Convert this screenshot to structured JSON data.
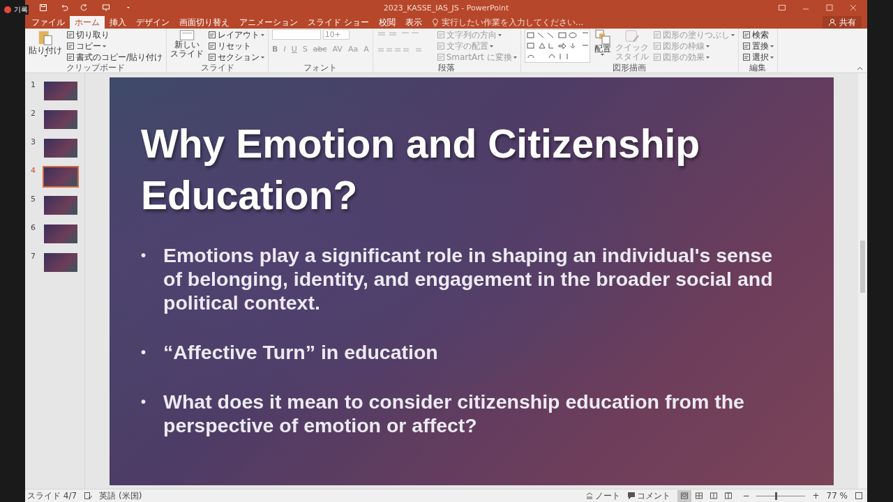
{
  "recording": {
    "label": "기록"
  },
  "window": {
    "title": "2023_KASSE_IAS_JS - PowerPoint"
  },
  "tabs": [
    {
      "label": "ファイル",
      "selected": false
    },
    {
      "label": "ホーム",
      "selected": true
    },
    {
      "label": "挿入",
      "selected": false
    },
    {
      "label": "デザイン",
      "selected": false
    },
    {
      "label": "画面切り替え",
      "selected": false
    },
    {
      "label": "アニメーション",
      "selected": false
    },
    {
      "label": "スライド ショー",
      "selected": false
    },
    {
      "label": "校閲",
      "selected": false
    },
    {
      "label": "表示",
      "selected": false
    }
  ],
  "tell_me": {
    "placeholder": "実行したい作業を入力してください..."
  },
  "share": {
    "label": "共有"
  },
  "ribbon": {
    "clipboard": {
      "label": "クリップボード",
      "paste": "貼り付け",
      "items": [
        {
          "label": "切り取り",
          "dropdown": false
        },
        {
          "label": "コピー",
          "dropdown": true
        },
        {
          "label": "書式のコピー/貼り付け",
          "dropdown": false
        }
      ]
    },
    "slides": {
      "label": "スライド",
      "new_slide": [
        "新しい",
        "スライド"
      ],
      "items": [
        {
          "label": "レイアウト",
          "dropdown": true
        },
        {
          "label": "リセット",
          "dropdown": false
        },
        {
          "label": "セクション",
          "dropdown": true
        }
      ]
    },
    "font": {
      "label": "フォント",
      "disabled": true,
      "font_size": "10+",
      "buttons": [
        "B",
        "I",
        "U",
        "S",
        "abc",
        "AV",
        "Aa",
        "A"
      ]
    },
    "paragraph": {
      "label": "段落",
      "disabled": true,
      "items": [
        {
          "label": "文字列の方向",
          "dropdown": true
        },
        {
          "label": "文字の配置",
          "dropdown": true
        },
        {
          "label": "SmartArt に変換",
          "dropdown": true
        }
      ]
    },
    "drawing": {
      "label": "図形描画",
      "arrange": "配置",
      "quick_style": [
        "クイック",
        "スタイル"
      ],
      "items": [
        {
          "label": "図形の塗りつぶし",
          "disabled": true,
          "dropdown": true
        },
        {
          "label": "図形の枠線",
          "disabled": true,
          "dropdown": true
        },
        {
          "label": "図形の効果",
          "disabled": true,
          "dropdown": true
        }
      ]
    },
    "editing": {
      "label": "編集",
      "items": [
        {
          "label": "検索",
          "dropdown": false
        },
        {
          "label": "置換",
          "dropdown": true
        },
        {
          "label": "選択",
          "dropdown": true
        }
      ]
    }
  },
  "thumbnails": [
    {
      "number": "1",
      "selected": false
    },
    {
      "number": "2",
      "selected": false
    },
    {
      "number": "3",
      "selected": false
    },
    {
      "number": "4",
      "selected": true
    },
    {
      "number": "5",
      "selected": false
    },
    {
      "number": "6",
      "selected": false
    },
    {
      "number": "7",
      "selected": false
    }
  ],
  "slide": {
    "title": "Why Emotion and Citizenship Education?",
    "bullet_marker": "•",
    "bullets": [
      "Emotions play a significant role in shaping an individual's sense of belonging, identity, and engagement in the broader social and political context.",
      "“Affective Turn” in education",
      "What does it mean to consider citizenship education from the perspective of emotion or affect?"
    ]
  },
  "status_bar": {
    "slide": "スライド 4/7",
    "language": "英語 (米国)",
    "notes": "ノート",
    "comments": "コメント",
    "views": [
      {
        "selected": true
      },
      {
        "selected": false
      },
      {
        "selected": false
      },
      {
        "selected": false
      }
    ],
    "zoom": {
      "out": "−",
      "in": "+",
      "level": 0.4,
      "reading": "77 %"
    }
  }
}
